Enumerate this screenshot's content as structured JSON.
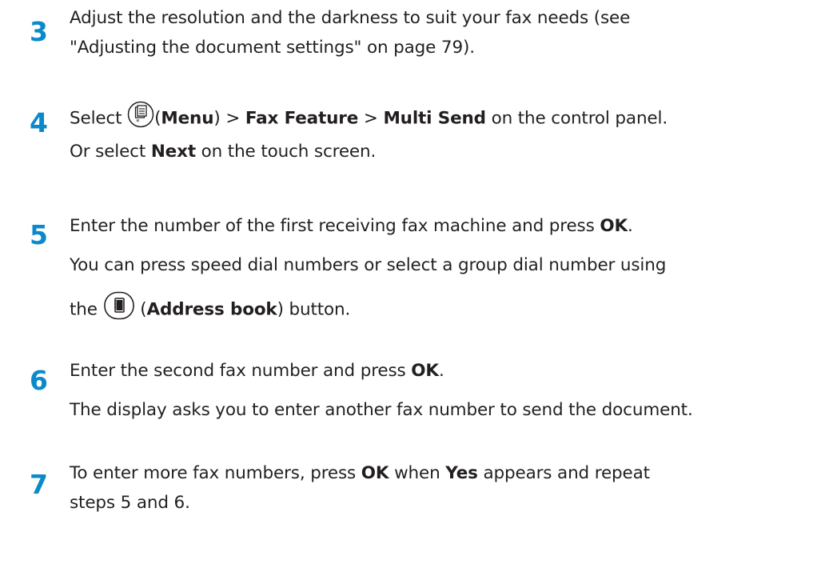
{
  "steps": [
    {
      "number": "3",
      "lines": [
        "Adjust the resolution and the darkness to suit your fax needs (see",
        "\"Adjusting the document settings\" on page 79)."
      ]
    },
    {
      "number": "4",
      "line1": {
        "select": "Select",
        "menu_open": "(",
        "menu": "Menu",
        "menu_close": ")",
        "sep1": ">",
        "fax_feature": "Fax Feature",
        "sep2": ">",
        "multi_send": "Multi Send",
        "tail": "on the control panel."
      },
      "line2": {
        "pre": "Or select",
        "next": "Next",
        "post": "on the touch screen."
      },
      "icon": "menu-button-icon"
    },
    {
      "number": "5",
      "line1": {
        "pre": "Enter the number of the first receiving fax machine and press",
        "ok": "OK",
        "post": "."
      },
      "line2": "You can press speed dial numbers or select a group dial number using",
      "line3": {
        "pre": "the",
        "open": "(",
        "address_book": "Address book",
        "close": ") button."
      },
      "icon": "address-book-button-icon"
    },
    {
      "number": "6",
      "line1": {
        "pre": "Enter the second fax number and press",
        "ok": "OK",
        "post": "."
      },
      "line2": "The display asks you to enter another fax number to send the document."
    },
    {
      "number": "7",
      "line1": {
        "pre": "To enter more fax numbers, press",
        "ok": "OK",
        "mid": "when",
        "yes": "Yes",
        "post": "appears and repeat"
      },
      "line2": "steps 5 and 6."
    }
  ],
  "colors": {
    "step_number": "#0a8acb",
    "text": "#231f20"
  }
}
